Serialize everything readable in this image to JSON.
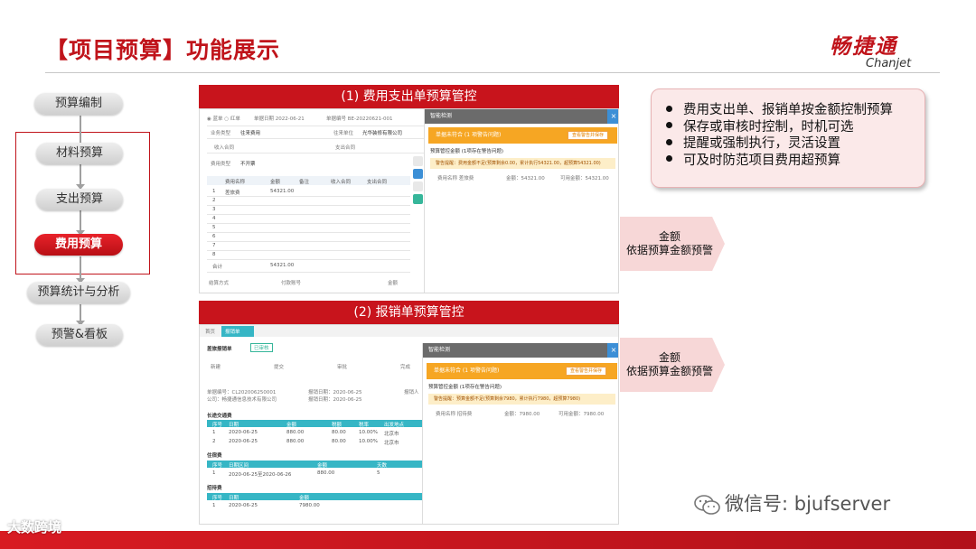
{
  "title": "【项目预算】功能展示",
  "logo": {
    "cn": "畅捷通",
    "en": "Chanjet"
  },
  "flow": {
    "nodes": [
      "预算编制",
      "材料预算",
      "支出预算",
      "费用预算",
      "预算统计与分析",
      "预警&看板"
    ],
    "active_index": 3
  },
  "screen1": {
    "banner": "(1) 费用支出单预算管控",
    "header_fields": [
      "单据日期 2022-06-21",
      "单据编号 BE-20220621-001"
    ],
    "form_labels": [
      "业务类型",
      "往来单位",
      "收入合同",
      "支出合同",
      "费用类型"
    ],
    "form_values": [
      "往来费用",
      "光华装修有限公司",
      "",
      "",
      "不开票"
    ],
    "table_headers": [
      "",
      "费用名称",
      "金额",
      "备注",
      "收入合同",
      "支出合同"
    ],
    "table_rows": [
      {
        "no": "1",
        "name": "差旅费",
        "amount": "54321.00"
      },
      {
        "no": "2",
        "name": "",
        "amount": ""
      },
      {
        "no": "3",
        "name": "",
        "amount": ""
      },
      {
        "no": "4",
        "name": "",
        "amount": ""
      },
      {
        "no": "5",
        "name": "",
        "amount": ""
      },
      {
        "no": "6",
        "name": "",
        "amount": ""
      },
      {
        "no": "7",
        "name": "",
        "amount": ""
      },
      {
        "no": "8",
        "name": "",
        "amount": ""
      }
    ],
    "total_label": "合计",
    "total_value": "54321.00",
    "footer_fields": [
      "结算方式",
      "付款账号",
      "金额"
    ],
    "panel": {
      "title": "智能检测",
      "close": "×",
      "warn_title": "单据未符合 (1 项警告问题)",
      "warn_button": "查看警告并保存",
      "section": "预算管控金额",
      "section_note": "(1项存在警告问题)",
      "note": "警告提醒：费用金额不足(预算剩余0.00，累计执行54321.00，超预算54321.00)",
      "row": [
        "费用名称 差旅费",
        "金额：54321.00",
        "可用金额：54321.00"
      ]
    }
  },
  "screen2": {
    "banner": "(2) 报销单预算管控",
    "tabs": [
      "首页",
      "报销单"
    ],
    "doc_title": "差旅报销单",
    "stamp": "已审核",
    "steps": [
      "新建",
      "提交",
      "审批",
      "完成"
    ],
    "info": [
      "单据编号：CL202006250001",
      "报销日期：2020-06-25",
      "报销人",
      "公司：畅捷通信息技术有限公司",
      "报销日期：2020-06-25"
    ],
    "sec1_title": "长途交通费",
    "sec1_headers": [
      "序号",
      "日期",
      "金额",
      "税额",
      "税率",
      "出发地点"
    ],
    "sec1_rows": [
      [
        "1",
        "2020-06-25",
        "880.00",
        "80.00",
        "10.00%",
        "北京市"
      ],
      [
        "2",
        "2020-06-25",
        "880.00",
        "80.00",
        "10.00%",
        "北京市"
      ]
    ],
    "sec2_title": "住宿费",
    "sec2_headers": [
      "序号",
      "日期区间",
      "金额",
      "天数"
    ],
    "sec2_rows": [
      [
        "1",
        "2020-06-25至2020-06-26",
        "880.00",
        "5"
      ]
    ],
    "sec3_title": "招待费",
    "sec3_headers": [
      "序号",
      "日期",
      "金额"
    ],
    "sec3_rows": [
      [
        "1",
        "2020-06-25",
        "7980.00"
      ]
    ],
    "panel": {
      "title": "智能检测",
      "close": "×",
      "warn_title": "单据未符合 (1 项警告问题)",
      "warn_button": "查看警告并保存",
      "section": "预算管控金额",
      "section_note": "(1项存在警告问题)",
      "note": "警告提醒：预算金额不足(预算剩余7980，累计执行7980，超预算7980)",
      "row": [
        "费用名称 招待费",
        "金额：7980.00",
        "可用金额：7980.00"
      ]
    }
  },
  "bullets": [
    "费用支出单、报销单按金额控制预算",
    "保存或审核时控制，时机可选",
    "提醒或强制执行，灵活设置",
    "可及时防范项目费用超预算"
  ],
  "callout1": [
    "金额",
    "依据预算金额预警"
  ],
  "callout2": [
    "金额",
    "依据预算金额预警"
  ],
  "wechat": "微信号: bjufserver",
  "footer_brand": "大数跨境",
  "colors": {
    "brand_red": "#c8141c",
    "warn_orange": "#f6a623",
    "teal": "#36b6c5",
    "callout_pink": "#f7d7d7"
  }
}
